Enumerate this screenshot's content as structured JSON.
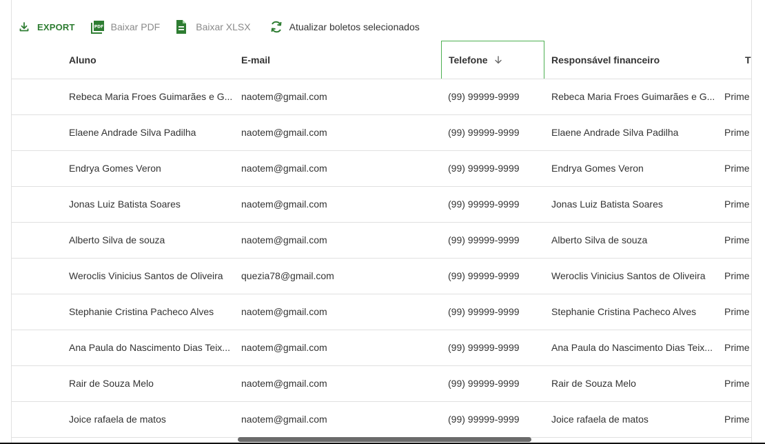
{
  "toolbar": {
    "export_label": "EXPORT",
    "pdf_label": "Baixar PDF",
    "xlsx_label": "Baixar XLSX",
    "refresh_label": "Atualizar boletos selecionados",
    "export_icon": "download-icon",
    "pdf_icon": "pdf-file-icon",
    "xlsx_icon": "spreadsheet-file-icon",
    "refresh_icon": "refresh-icon"
  },
  "columns": {
    "aluno": "Aluno",
    "email": "E-mail",
    "telefone": "Telefone",
    "responsavel": "Responsável financeiro",
    "t": "T"
  },
  "sort": {
    "column": "Telefone",
    "direction": "descending",
    "icon": "arrow-down-icon"
  },
  "rows": [
    {
      "aluno": "Rebeca Maria Froes Guimarães e G...",
      "email": "naotem@gmail.com",
      "telefone": "(99) 99999-9999",
      "responsavel": "Rebeca Maria Froes Guimarães e G...",
      "t": "Prime"
    },
    {
      "aluno": "Elaene Andrade Silva Padilha",
      "email": "naotem@gmail.com",
      "telefone": "(99) 99999-9999",
      "responsavel": "Elaene Andrade Silva Padilha",
      "t": "Prime"
    },
    {
      "aluno": "Endrya Gomes Veron",
      "email": "naotem@gmail.com",
      "telefone": "(99) 99999-9999",
      "responsavel": "Endrya Gomes Veron",
      "t": "Prime"
    },
    {
      "aluno": "Jonas Luiz Batista Soares",
      "email": "naotem@gmail.com",
      "telefone": "(99) 99999-9999",
      "responsavel": "Jonas Luiz Batista Soares",
      "t": "Prime"
    },
    {
      "aluno": "Alberto Silva de souza",
      "email": "naotem@gmail.com",
      "telefone": "(99) 99999-9999",
      "responsavel": "Alberto Silva de souza",
      "t": "Prime"
    },
    {
      "aluno": "Weroclis Vinicius Santos de Oliveira",
      "email": "quezia78@gmail.com",
      "telefone": "(99) 99999-9999",
      "responsavel": "Weroclis Vinicius Santos de Oliveira",
      "t": "Prime"
    },
    {
      "aluno": "Stephanie Cristina Pacheco Alves",
      "email": "naotem@gmail.com",
      "telefone": "(99) 99999-9999",
      "responsavel": "Stephanie Cristina Pacheco Alves",
      "t": "Prime"
    },
    {
      "aluno": "Ana Paula do Nascimento Dias Teix...",
      "email": "naotem@gmail.com",
      "telefone": "(99) 99999-9999",
      "responsavel": "Ana Paula do Nascimento Dias Teix...",
      "t": "Prime"
    },
    {
      "aluno": "Rair de Souza Melo",
      "email": "naotem@gmail.com",
      "telefone": "(99) 99999-9999",
      "responsavel": "Rair de Souza Melo",
      "t": "Prime"
    },
    {
      "aluno": "Joice rafaela de matos",
      "email": "naotem@gmail.com",
      "telefone": "(99) 99999-9999",
      "responsavel": "Joice rafaela de matos",
      "t": "Prime"
    }
  ]
}
